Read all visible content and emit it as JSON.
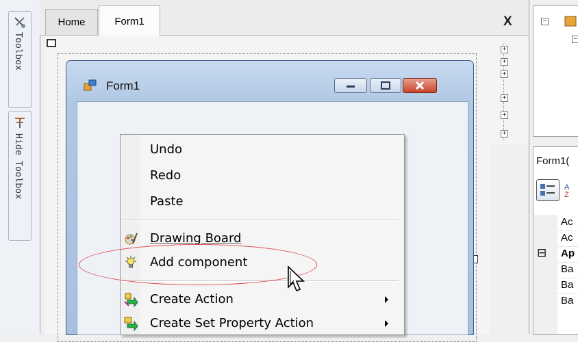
{
  "toolbox": {
    "toolbox_label": "Toolbox",
    "hide_toolbox_label": "Hide Toolbox"
  },
  "tabs": [
    {
      "label": "Home"
    },
    {
      "label": "Form1"
    }
  ],
  "close_label": "X",
  "form": {
    "title": "Form1"
  },
  "context_menu": {
    "items": [
      {
        "label": "Undo"
      },
      {
        "label": "Redo"
      },
      {
        "label": "Paste"
      },
      {
        "label": "Drawing Board",
        "icon": "drawing-board-icon"
      },
      {
        "label": "Add component",
        "icon": "lightbulb-icon"
      },
      {
        "label": "Create Action",
        "icon": "create-action-icon",
        "submenu": true
      },
      {
        "label": "Create Set Property Action",
        "icon": "create-set-property-action-icon",
        "submenu": true
      }
    ]
  },
  "properties": {
    "header": "Form1(",
    "rows": [
      {
        "label": "Ac"
      },
      {
        "label": "Ac"
      },
      {
        "label": "Ap",
        "expander": "⊟",
        "bold": true
      },
      {
        "label": "Ba"
      },
      {
        "label": "Ba"
      },
      {
        "label": "Ba"
      }
    ]
  },
  "colors": {
    "highlight_ellipse": "#e04a50",
    "close_button": "#c8432a",
    "title_gradient": "#b1c8e4"
  }
}
